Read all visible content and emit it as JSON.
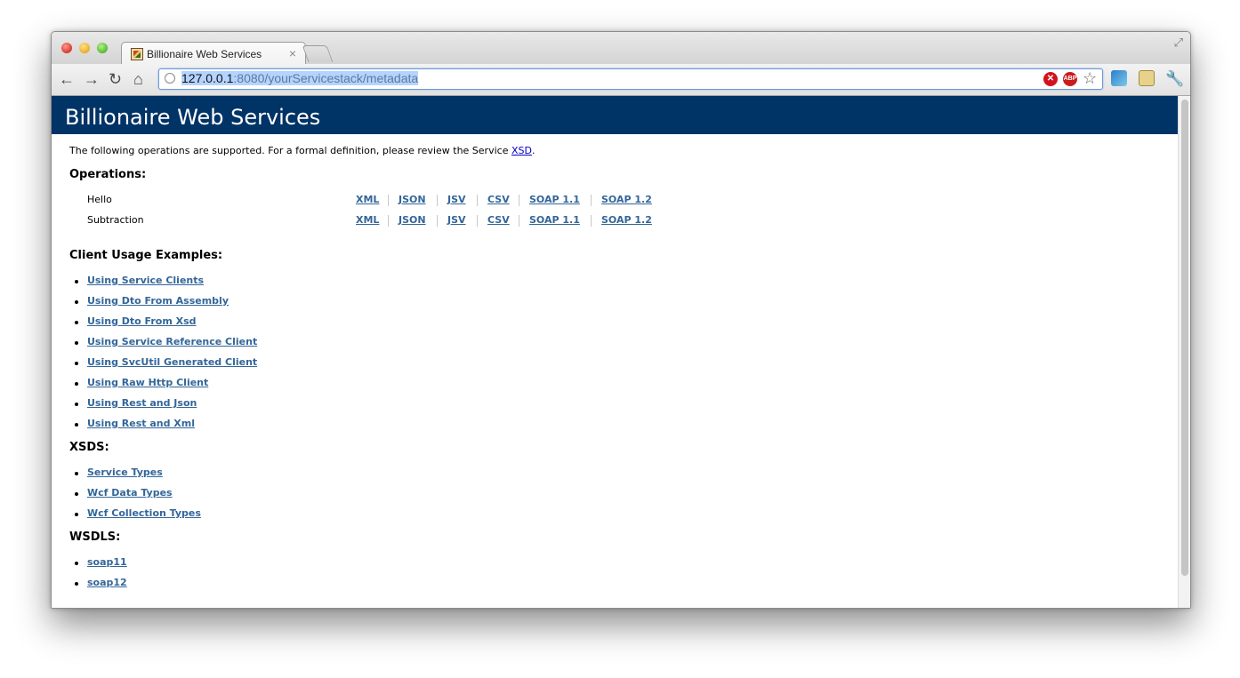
{
  "browser": {
    "tab_title": "Billionaire Web Services",
    "tab_close": "×",
    "url_host": "127.0.0.1",
    "url_rest": ":8080/yourServicestack/metadata",
    "ext_red_label": "✕",
    "ext_abp_label": "ABP",
    "icons": {
      "back": "←",
      "forward": "→",
      "reload": "↻",
      "home": "⌂",
      "star": "☆",
      "wrench": "🔧",
      "fullscreen": "⤢"
    }
  },
  "page": {
    "banner_title": "Billionaire Web Services",
    "intro_text": "The following operations are supported. For a formal definition, please review the Service ",
    "intro_link": "XSD",
    "intro_end": ".",
    "operations_heading": "Operations:",
    "operations": [
      {
        "name": "Hello",
        "links": [
          "XML",
          "JSON",
          "JSV",
          "CSV",
          "SOAP 1.1",
          "SOAP 1.2"
        ]
      },
      {
        "name": "Subtraction",
        "links": [
          "XML",
          "JSON",
          "JSV",
          "CSV",
          "SOAP 1.1",
          "SOAP 1.2"
        ]
      }
    ],
    "client_heading": "Client Usage Examples:",
    "client_examples": [
      "Using Service Clients",
      "Using Dto From Assembly",
      "Using Dto From Xsd",
      "Using Service Reference Client",
      "Using SvcUtil Generated Client",
      "Using Raw Http Client",
      "Using Rest and Json",
      "Using Rest and Xml"
    ],
    "xsds_heading": "XSDS:",
    "xsds": [
      "Service Types",
      "Wcf Data Types",
      "Wcf Collection Types"
    ],
    "wsdls_heading": "WSDLS:",
    "wsdls": [
      "soap11",
      "soap12"
    ]
  },
  "colors": {
    "banner": "#003366",
    "link": "#336699",
    "intro_link": "#0000cc"
  }
}
